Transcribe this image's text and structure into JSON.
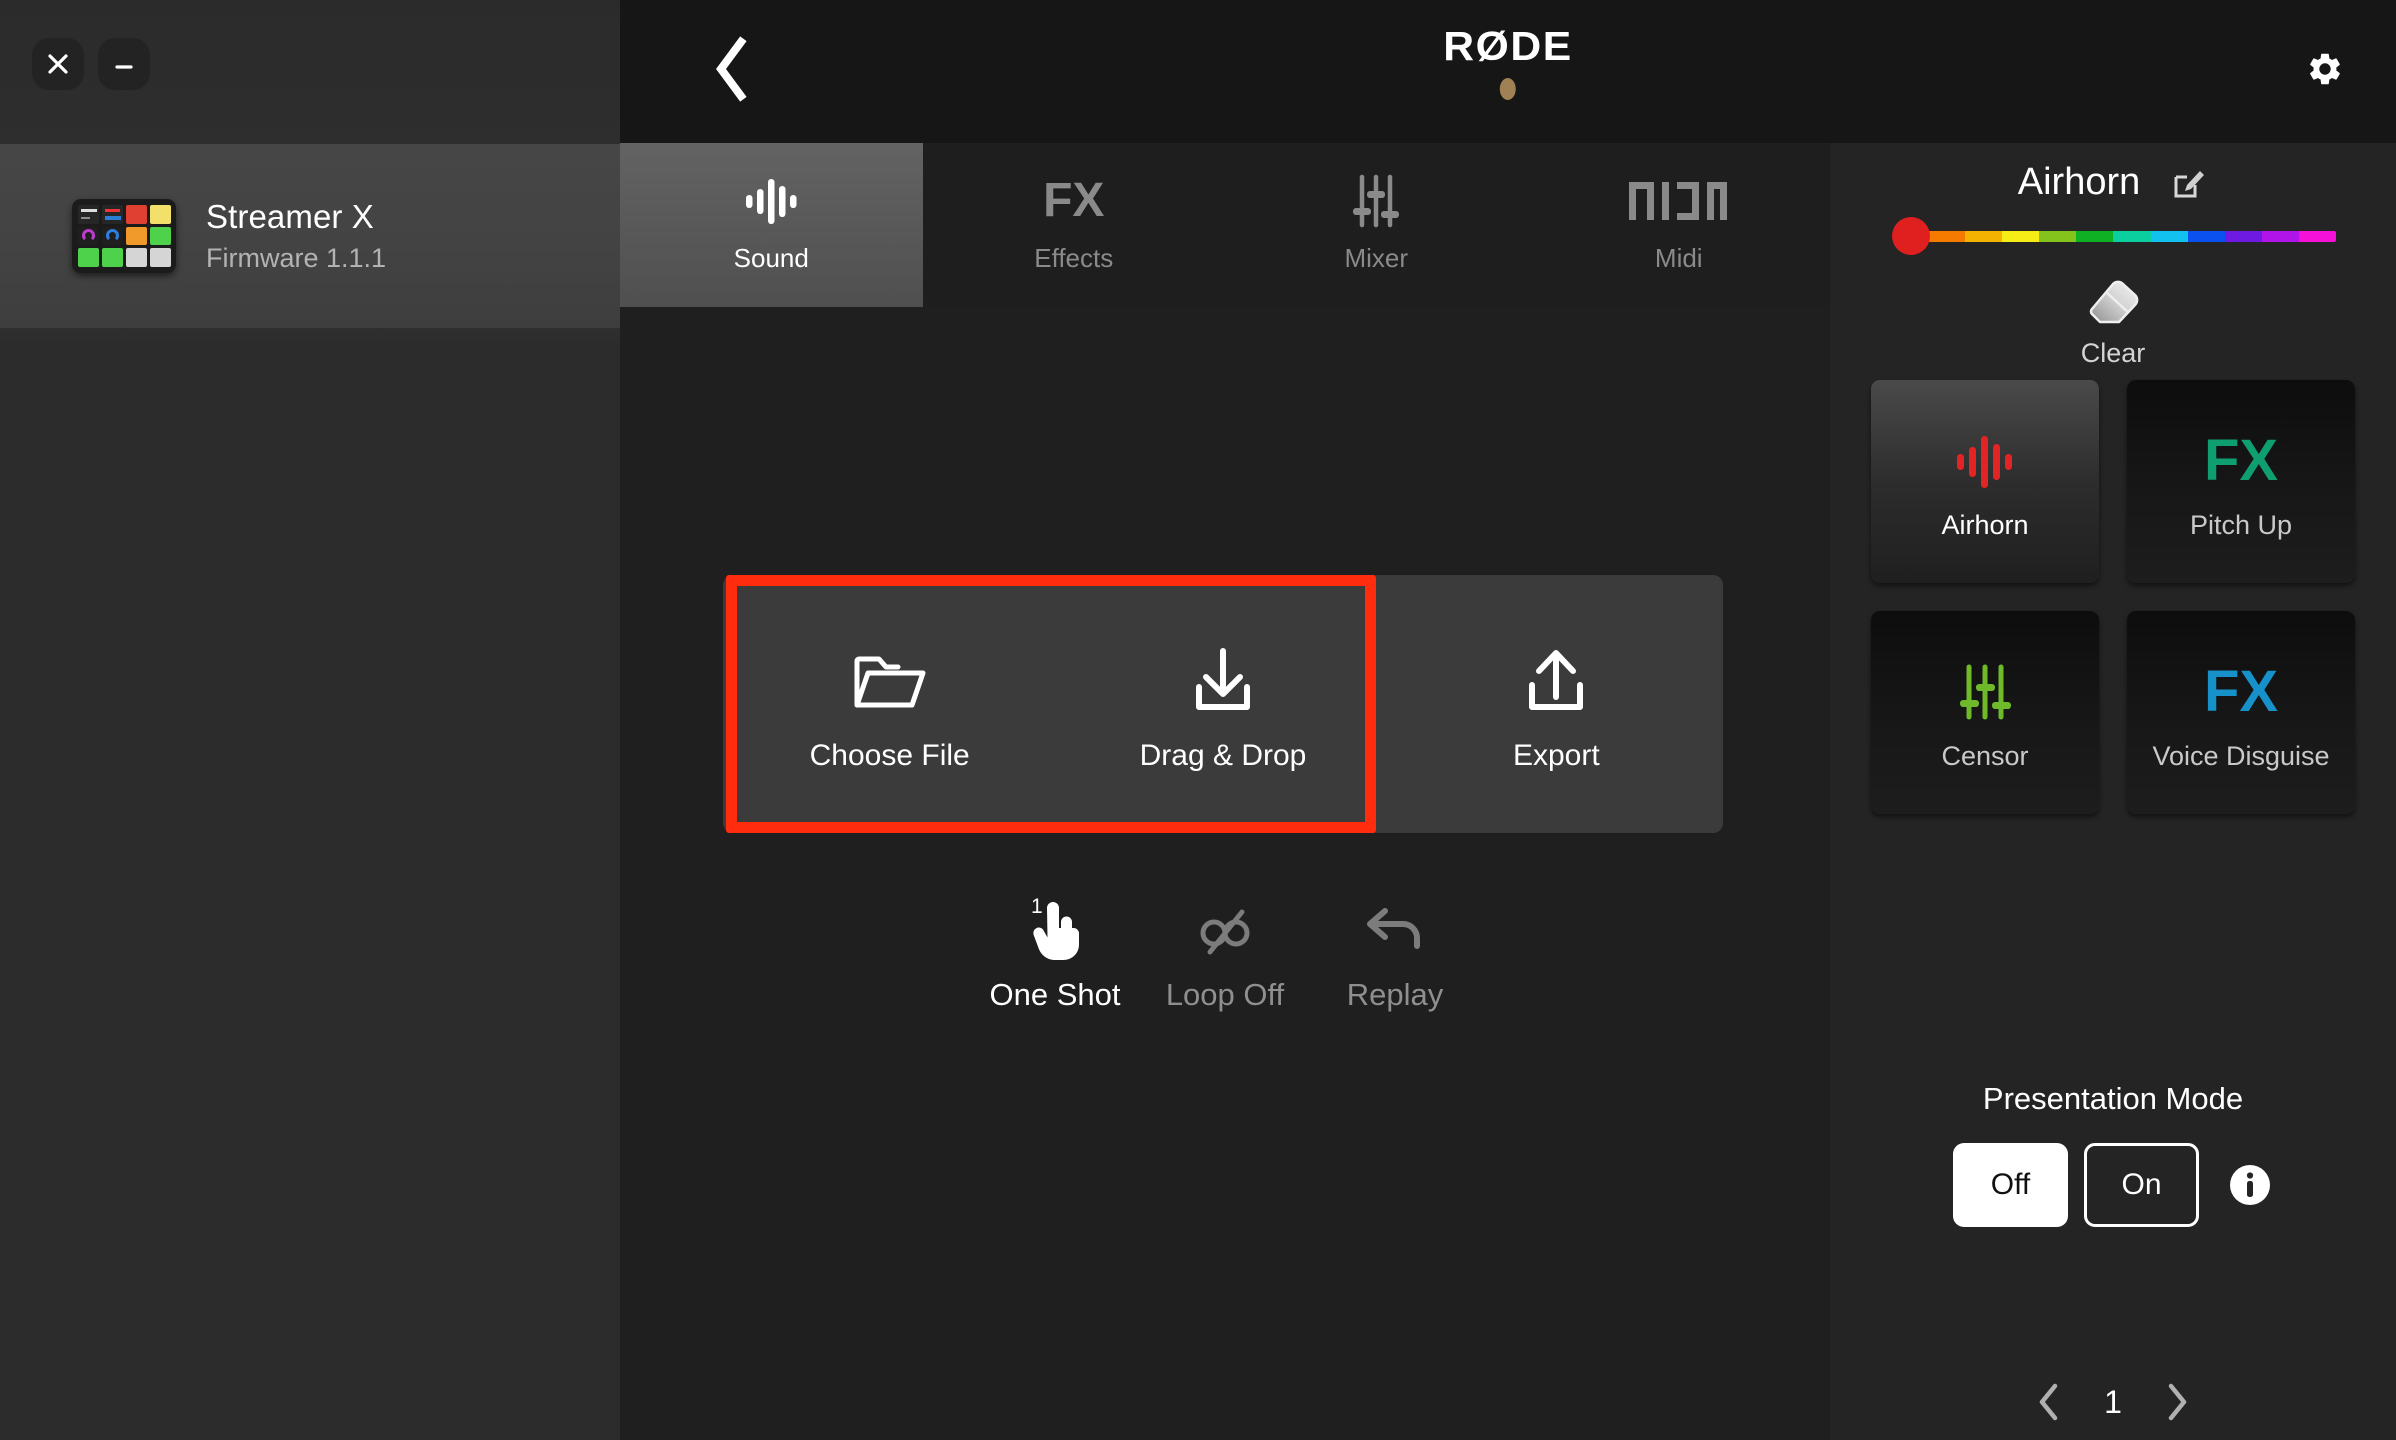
{
  "window": {
    "close_label": "×",
    "minimize_label": "—"
  },
  "sidebar": {
    "device": {
      "name": "Streamer X",
      "firmware": "Firmware 1.1.1"
    }
  },
  "topbar": {
    "back_icon": "chevron-left-icon",
    "brand": "RØDE",
    "settings_icon": "gear-icon"
  },
  "tabs": [
    {
      "label": "Sound",
      "icon": "waveform-icon",
      "active": true
    },
    {
      "label": "Effects",
      "icon": "fx-text-icon",
      "active": false
    },
    {
      "label": "Mixer",
      "icon": "sliders-icon",
      "active": false
    },
    {
      "label": "Midi",
      "icon": "midi-icon",
      "active": false
    }
  ],
  "main": {
    "io_buttons": [
      {
        "label": "Choose File",
        "icon": "folder-icon"
      },
      {
        "label": "Drag & Drop",
        "icon": "download-arrow-icon"
      },
      {
        "label": "Export",
        "icon": "upload-arrow-icon"
      }
    ],
    "highlight_color": "#ff2d0d",
    "play_modes": [
      {
        "label": "One Shot",
        "icon": "tap-hand-icon",
        "badge": "1",
        "active": true
      },
      {
        "label": "Loop Off",
        "icon": "loop-off-icon",
        "badge": "",
        "active": false
      },
      {
        "label": "Replay",
        "icon": "undo-arrow-icon",
        "badge": "",
        "active": false
      }
    ]
  },
  "right_panel": {
    "title": "Airhorn",
    "edit_icon": "edit-pencil-icon",
    "color_slider": {
      "thumb_color": "#e01f1f",
      "segments": [
        "#f47a00",
        "#f5b301",
        "#f6ec16",
        "#84c21c",
        "#0fb023",
        "#0ccfa0",
        "#13c1ee",
        "#0a51f0",
        "#6f1ae3",
        "#b014e8",
        "#f511d8"
      ]
    },
    "clear": {
      "label": "Clear",
      "icon": "eraser-icon"
    },
    "pads": [
      {
        "label": "Airhorn",
        "icon": "waveform-icon",
        "color": "#e32424",
        "selected": true
      },
      {
        "label": "Pitch Up",
        "icon": "fx-text-icon",
        "color": "#0f9e70",
        "selected": false
      },
      {
        "label": "Censor",
        "icon": "sliders-icon",
        "color": "#6fba2a",
        "selected": false
      },
      {
        "label": "Voice Disguise",
        "icon": "fx-text-icon",
        "color": "#1691c9",
        "selected": false
      }
    ],
    "presentation_mode": {
      "title": "Presentation Mode",
      "off_label": "Off",
      "on_label": "On",
      "selected": "Off",
      "info_icon": "info-icon"
    },
    "pager": {
      "prev_icon": "chevron-left-icon",
      "next_icon": "chevron-right-icon",
      "page": "1"
    }
  }
}
